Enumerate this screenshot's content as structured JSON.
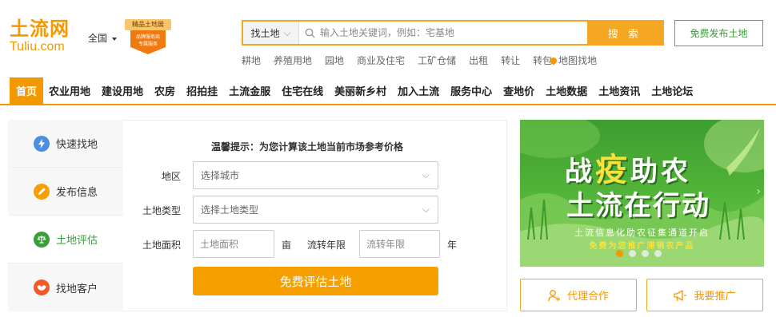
{
  "header": {
    "logo_cn": "土流网",
    "logo_en": "Tuliu.com",
    "region": "全国",
    "badge_title": "精品土地展",
    "badge_line1": "品牌服务商",
    "badge_line2": "专属服务"
  },
  "search": {
    "type_label": "找土地",
    "placeholder": "输入土地关键词，例如：宅基地",
    "button_label": "搜 索"
  },
  "publish_button": "免费发布土地",
  "quick_links": [
    "耕地",
    "养殖用地",
    "园地",
    "商业及住宅",
    "工矿仓储",
    "出租",
    "转让",
    "转包"
  ],
  "map_link": "地图找地",
  "nav": [
    "首页",
    "农业用地",
    "建设用地",
    "农房",
    "招拍挂",
    "土流金服",
    "住宅在线",
    "美丽新乡村",
    "加入土流",
    "服务中心",
    "查地价",
    "土地数据",
    "土地资讯",
    "土地论坛"
  ],
  "sidebar": {
    "items": [
      {
        "label": "快速找地",
        "color": "#4a90e2"
      },
      {
        "label": "发布信息",
        "color": "#f5a000"
      },
      {
        "label": "土地评估",
        "color": "#3a9e3a"
      },
      {
        "label": "找地客户",
        "color": "#f05a28"
      }
    ]
  },
  "form": {
    "title": "温馨提示：为您计算该土地当前市场参考价格",
    "region_label": "地区",
    "region_placeholder": "选择城市",
    "type_label": "土地类型",
    "type_placeholder": "选择土地类型",
    "area_label": "土地面积",
    "area_placeholder": "土地面积",
    "area_unit": "亩",
    "term_label": "流转年限",
    "term_placeholder": "流转年限",
    "term_unit": "年",
    "submit_label": "免费评估土地"
  },
  "banner": {
    "line1_a": "战",
    "line1_b": "疫",
    "line1_c": "助农",
    "line2": "土流在行动",
    "line3": "土流信息化助农征集通道开启",
    "line4": "免费为您推广滞销农产品"
  },
  "actions": {
    "agent": "代理合作",
    "promote": "我要推广"
  },
  "colors": {
    "brand": "#f39800",
    "green": "#3a9e3a"
  }
}
